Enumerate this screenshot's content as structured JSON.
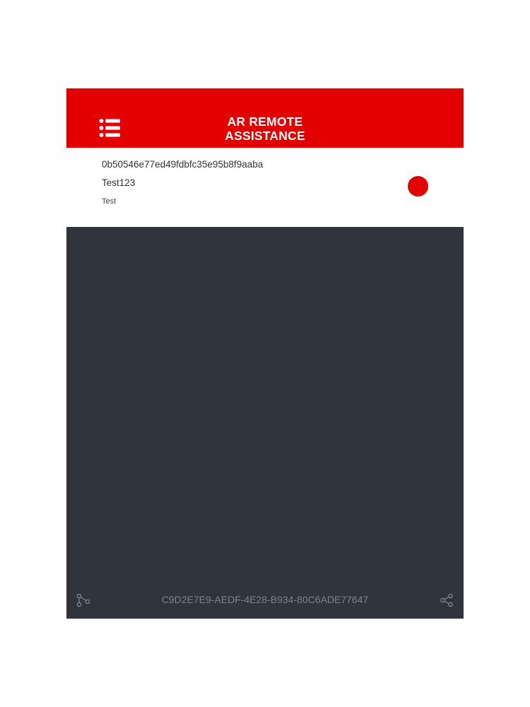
{
  "header": {
    "title_line1": "AR REMOTE",
    "title_line2": "ASSISTANCE",
    "menu_icon": "list-menu-icon"
  },
  "session": {
    "id": "0b50546e77ed49fdbfc35e95b8f9aaba",
    "name": "Test123",
    "description": "Test"
  },
  "video": {
    "device_id": "C9D2E7E9-AEDF-4E28-B934-80C6ADE77647",
    "left_icon": "connection-icon",
    "right_icon": "share-icon"
  },
  "colors": {
    "brand_red": "#e20000",
    "video_bg": "#30353d",
    "footer_text": "#7d828a"
  }
}
